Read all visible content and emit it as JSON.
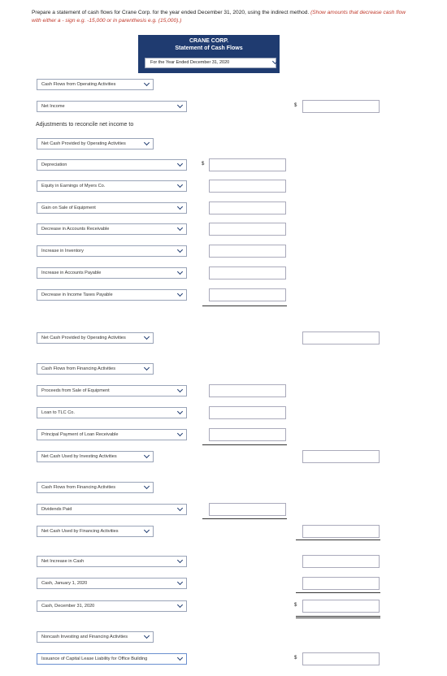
{
  "instructions": {
    "text": "Prepare a statement of cash flows for Crane Corp. for the year ended December 31, 2020, using the indirect method.",
    "note": "(Show amounts that decrease cash flow with either a - sign e.g. -15,000 or in parenthesis e.g. (15,000).)"
  },
  "header": {
    "company": "CRANE CORP.",
    "statement": "Statement of Cash Flows",
    "period": "For the Year Ended December 31, 2020"
  },
  "adjustments_label": "Adjustments to reconcile net income to",
  "currency_symbol": "$",
  "rows": {
    "operating_header": "Cash Flows from Operating Activities",
    "net_income": "Net Income",
    "net_cash_operating_sub": "Net Cash Provided by Operating Activities",
    "depreciation": "Depreciation",
    "equity_earnings": "Equity in Earnings of Myers Co.",
    "gain_sale": "Gain on Sale of Equipment",
    "decrease_ar": "Decrease in Accounts Receivable",
    "increase_inventory": "Increase in Inventory",
    "increase_ap": "Increase in Accounts Payable",
    "decrease_tax": "Decrease in Income Taxes Payable",
    "net_cash_operating": "Net Cash Provided by Operating Activities",
    "investing_header": "Cash Flows from Financing Activities",
    "proceeds_equipment": "Proceeds from Sale of Equipment",
    "loan_tlc": "Loan to TLC Co.",
    "principal_loan": "Principal Payment of Loan Receivable",
    "net_cash_investing": "Net Cash Used by Investing Activities",
    "financing_header": "Cash Flows from Financing Activities",
    "dividends": "Dividends Paid",
    "net_cash_financing": "Net Cash Used by Financing Activities",
    "net_increase": "Net Increase in Cash",
    "cash_jan": "Cash, January 1, 2020",
    "cash_dec": "Cash, December 31, 2020",
    "noncash_header": "Noncash Investing and Financing Activities",
    "capital_lease": "Issuance of Capital Lease Liability for Office Building"
  }
}
